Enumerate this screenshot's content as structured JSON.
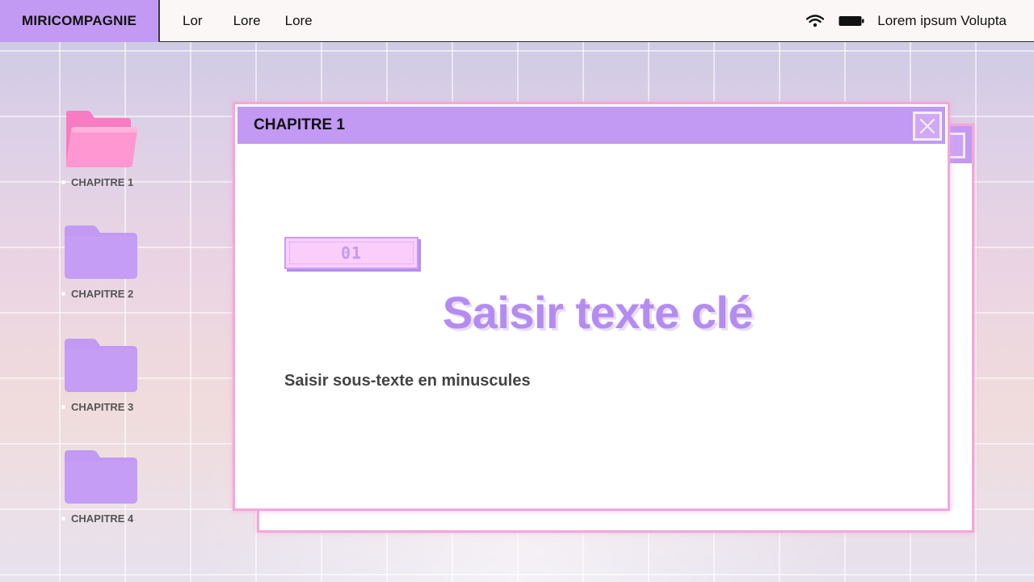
{
  "menubar": {
    "brand": "MIRICOMPAGNIE",
    "items": [
      "Lor",
      "Lore",
      "Lore"
    ],
    "status_label": "Lorem ipsum Volupta",
    "icons": [
      "wifi-icon",
      "battery-icon"
    ]
  },
  "sidebar": {
    "folders": [
      {
        "label": "CHAPITRE 1",
        "color": "#ff86c8",
        "state": "open"
      },
      {
        "label": "CHAPITRE 2",
        "color": "#c299f3",
        "state": "closed"
      },
      {
        "label": "CHAPITRE 3",
        "color": "#c299f3",
        "state": "closed"
      },
      {
        "label": "CHAPITRE 4",
        "color": "#c299f3",
        "state": "closed"
      }
    ]
  },
  "window": {
    "title": "CHAPITRE 1",
    "number": "01",
    "headline": "Saisir texte clé",
    "subtext": "Saisir sous-texte en minuscules"
  },
  "colors": {
    "accent_purple": "#c299f3",
    "accent_pink": "#f2a8d9",
    "headline": "#b48cf0",
    "badge_fill": "#fbcdfb"
  }
}
